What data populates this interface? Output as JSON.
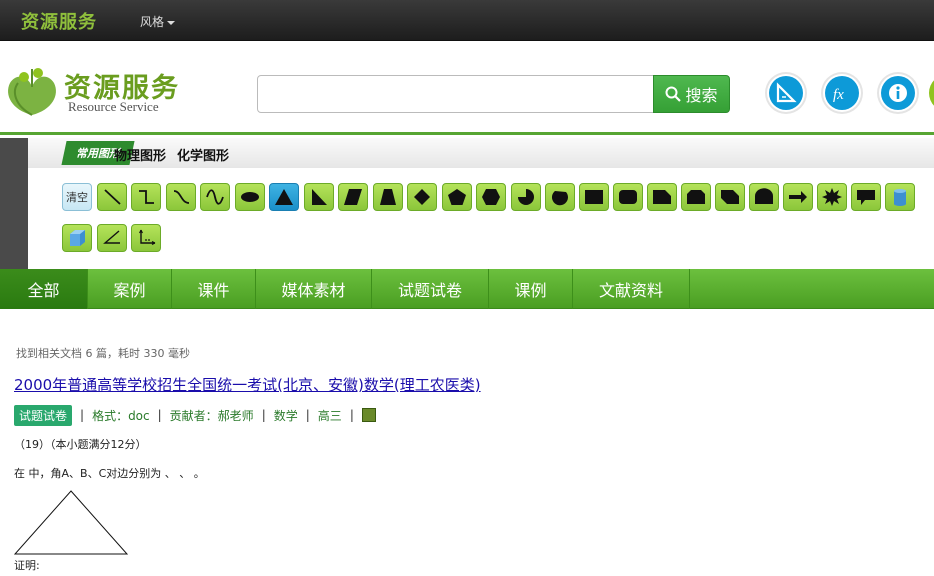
{
  "topbar": {
    "brand": "资源服务",
    "style_menu": "风格"
  },
  "header": {
    "logo_title": "资源服务",
    "logo_subtitle": "Resource Service",
    "search_value": "",
    "search_button": "搜索",
    "tool_icons": [
      "ruler-icon",
      "function-icon",
      "info-icon"
    ]
  },
  "shapes": {
    "tabs": [
      "常用图形",
      "物理图形",
      "化学图形"
    ],
    "clear_label": "清空",
    "tools": [
      "line",
      "step-line",
      "curve",
      "wave",
      "ellipse",
      "triangle",
      "right-triangle",
      "parallelogram",
      "trapezoid",
      "diamond",
      "pentagon",
      "hexagon",
      "pie",
      "chord",
      "rectangle",
      "rounded-rectangle",
      "snip-corner-rectangle",
      "octagon",
      "snip-diagonal-rectangle",
      "round-top-rectangle",
      "arrow",
      "starburst",
      "speech-bubble",
      "cylinder",
      "cube",
      "angle",
      "axes"
    ]
  },
  "nav": {
    "items": [
      "全部",
      "案例",
      "课件",
      "媒体素材",
      "试题试卷",
      "课例",
      "文献资料"
    ],
    "active": 0
  },
  "results": {
    "count_text": "找到相关文档 6 篇，耗时 330 毫秒",
    "items": [
      {
        "title": "2000年普通高等学校招生全国统一考试(北京、安徽)数学(理工农医类)",
        "type_badge": "试题试卷",
        "format": "格式：doc",
        "contributor": "贡献者：郝老师",
        "subject": "数学",
        "grade": "高三",
        "snippet_lines": [
          "（19）（本小题满分12分）",
          "在 中，角A、B、C对边分别为 、 、 。",
          "证明:"
        ]
      }
    ]
  },
  "colors": {
    "brand_green": "#57a532",
    "nav_green": "#5cb030",
    "accent_blue": "#0d9ad8",
    "link_blue": "#1a0dab"
  }
}
